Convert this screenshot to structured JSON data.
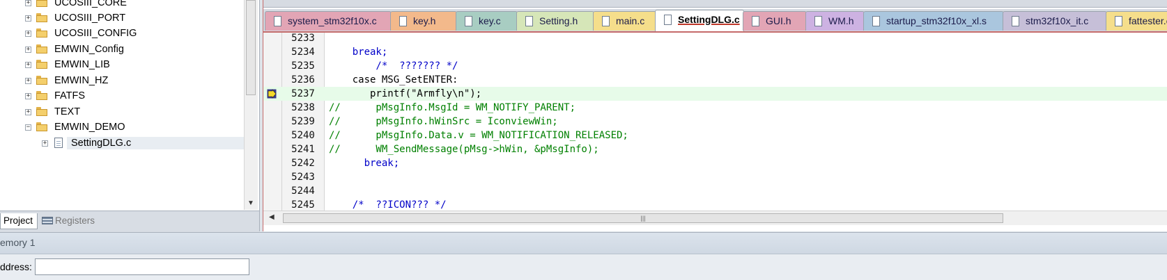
{
  "project_tree": {
    "items": [
      {
        "label": "UCOSIII_CORE",
        "type": "folder",
        "expander": "+"
      },
      {
        "label": "UCOSIII_PORT",
        "type": "folder",
        "expander": "+"
      },
      {
        "label": "UCOSIII_CONFIG",
        "type": "folder",
        "expander": "+"
      },
      {
        "label": "EMWIN_Config",
        "type": "folder",
        "expander": "+"
      },
      {
        "label": "EMWIN_LIB",
        "type": "folder",
        "expander": "+"
      },
      {
        "label": "EMWIN_HZ",
        "type": "folder",
        "expander": "+"
      },
      {
        "label": "FATFS",
        "type": "folder",
        "expander": "+"
      },
      {
        "label": "TEXT",
        "type": "folder",
        "expander": "+"
      },
      {
        "label": "EMWIN_DEMO",
        "type": "folder-open",
        "expander": "−"
      },
      {
        "label": "SettingDLG.c",
        "type": "file",
        "expander": "+",
        "selected": true
      }
    ]
  },
  "left_tabs": {
    "project": "Project",
    "registers": "Registers"
  },
  "file_tabs": [
    {
      "label": "system_stm32f10x.c",
      "color": "#e2a5b5"
    },
    {
      "label": "key.h",
      "color": "#f3b98b"
    },
    {
      "label": "key.c",
      "color": "#a8cdc2"
    },
    {
      "label": "Setting.h",
      "color": "#d6e6b8"
    },
    {
      "label": "main.c",
      "color": "#f5de8b"
    },
    {
      "label": "SettingDLG.c",
      "color": "#ffffff",
      "active": true
    },
    {
      "label": "GUI.h",
      "color": "#e2a5b5"
    },
    {
      "label": "WM.h",
      "color": "#cdb2e2"
    },
    {
      "label": "startup_stm32f10x_xl.s",
      "color": "#aac6de"
    },
    {
      "label": "stm32f10x_it.c",
      "color": "#c6bfd8"
    },
    {
      "label": "fattester.c",
      "color": "#f5de8b"
    }
  ],
  "code": {
    "current_line": "5237",
    "lines": [
      {
        "num": "5233",
        "text": "",
        "style": "black"
      },
      {
        "num": "5234",
        "text": "    break;",
        "style": "blue"
      },
      {
        "num": "5235",
        "text": "        /*  ??????? */",
        "style": "blue"
      },
      {
        "num": "5236",
        "text": "    case MSG_SetENTER:",
        "style": "black"
      },
      {
        "num": "5237",
        "text": "       printf(\"Armfly\\n\");",
        "style": "black"
      },
      {
        "num": "5238",
        "text": "//      pMsgInfo.MsgId = WM_NOTIFY_PARENT;",
        "style": "green"
      },
      {
        "num": "5239",
        "text": "//      pMsgInfo.hWinSrc = IconviewWin;",
        "style": "green"
      },
      {
        "num": "5240",
        "text": "//      pMsgInfo.Data.v = WM_NOTIFICATION_RELEASED;",
        "style": "green"
      },
      {
        "num": "5241",
        "text": "//      WM_SendMessage(pMsg->hWin, &pMsgInfo);",
        "style": "green"
      },
      {
        "num": "5242",
        "text": "      break;",
        "style": "blue"
      },
      {
        "num": "5243",
        "text": "",
        "style": "black"
      },
      {
        "num": "5244",
        "text": "",
        "style": "black"
      },
      {
        "num": "5245",
        "text": "    /*  ??ICON??? */",
        "style": "blue"
      }
    ]
  },
  "memory": {
    "title": "emory 1",
    "address_label": "ddress:",
    "address_value": ""
  },
  "icons": {
    "tree_expander": "plus-box-icon",
    "folder": "folder-icon",
    "file": "c-file-icon",
    "breakpoint": "current-line-arrow-icon",
    "scroll_down": "▼",
    "scroll_left": "◀",
    "scroll_grip": "|||"
  }
}
